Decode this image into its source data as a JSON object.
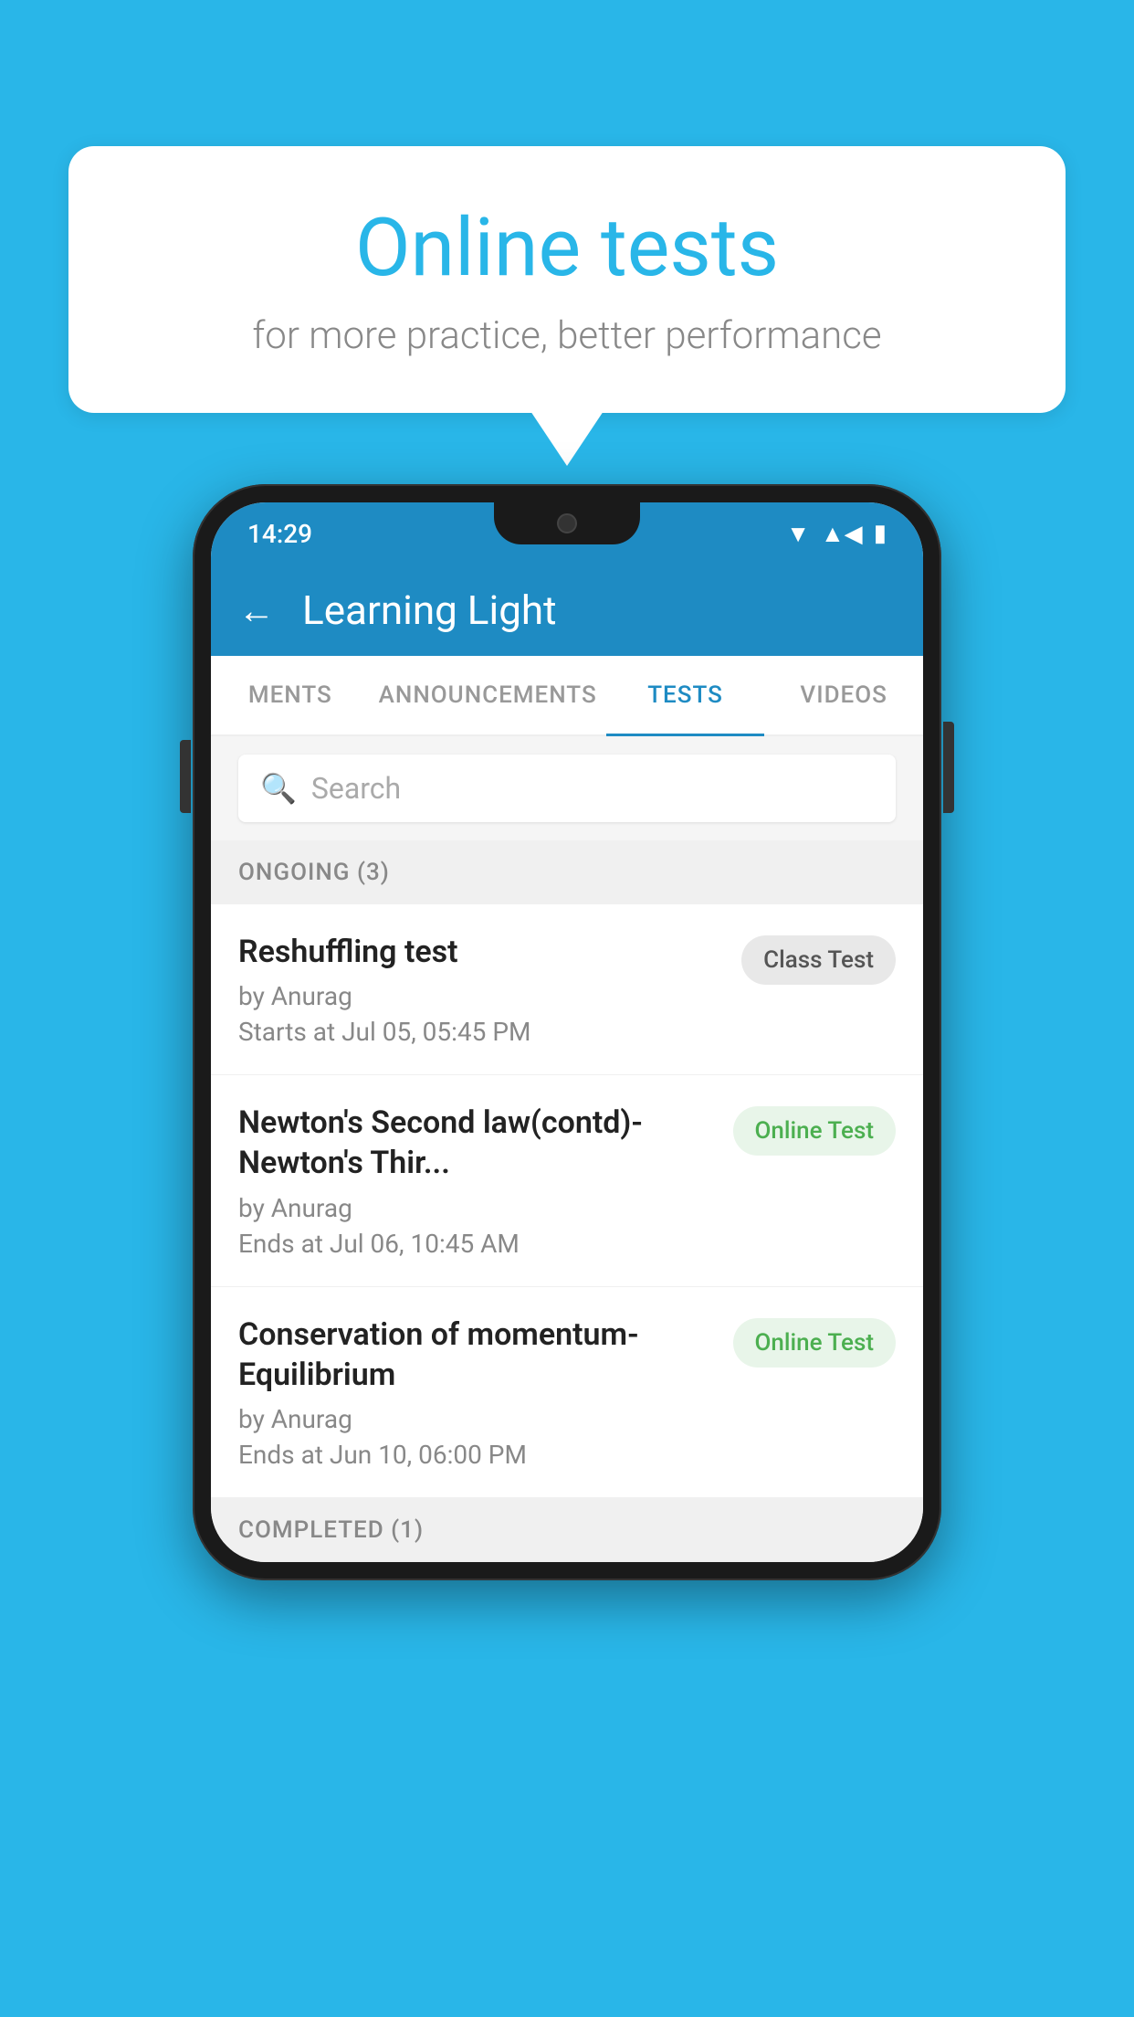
{
  "background": {
    "color": "#29b6e8"
  },
  "speech_bubble": {
    "title": "Online tests",
    "subtitle": "for more practice, better performance"
  },
  "phone": {
    "status_bar": {
      "time": "14:29",
      "wifi": "▼",
      "signal": "▲",
      "battery": "▮"
    },
    "app_bar": {
      "title": "Learning Light",
      "back_label": "←"
    },
    "tabs": [
      {
        "label": "MENTS",
        "active": false
      },
      {
        "label": "ANNOUNCEMENTS",
        "active": false
      },
      {
        "label": "TESTS",
        "active": true
      },
      {
        "label": "VIDEOS",
        "active": false
      }
    ],
    "search": {
      "placeholder": "Search"
    },
    "ongoing_section": {
      "label": "ONGOING (3)"
    },
    "test_items": [
      {
        "name": "Reshuffling test",
        "by": "by Anurag",
        "time": "Starts at  Jul 05, 05:45 PM",
        "badge": "Class Test",
        "badge_type": "class"
      },
      {
        "name": "Newton's Second law(contd)-Newton's Thir...",
        "by": "by Anurag",
        "time": "Ends at  Jul 06, 10:45 AM",
        "badge": "Online Test",
        "badge_type": "online"
      },
      {
        "name": "Conservation of momentum-Equilibrium",
        "by": "by Anurag",
        "time": "Ends at  Jun 10, 06:00 PM",
        "badge": "Online Test",
        "badge_type": "online"
      }
    ],
    "completed_section": {
      "label": "COMPLETED (1)"
    }
  }
}
